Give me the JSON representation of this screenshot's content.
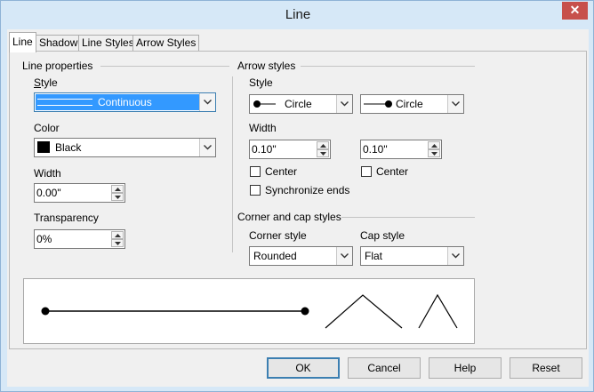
{
  "window": {
    "title": "Line",
    "close_glyph": "✕"
  },
  "tabs": [
    {
      "label": "Line",
      "active": true
    },
    {
      "label": "Shadow",
      "active": false
    },
    {
      "label": "Line Styles",
      "active": false
    },
    {
      "label": "Arrow Styles",
      "active": false
    }
  ],
  "line_properties": {
    "title": "Line properties",
    "style_label": "Style",
    "style_value": "Continuous",
    "color_label": "Color",
    "color_value": "Black",
    "color_swatch": "#000000",
    "width_label": "Width",
    "width_value": "0.00\"",
    "transparency_label": "Transparency",
    "transparency_value": "0%"
  },
  "arrow_styles": {
    "title": "Arrow styles",
    "style_label": "Style",
    "start_style": "Circle",
    "end_style": "Circle",
    "width_label": "Width",
    "start_width": "0.10\"",
    "end_width": "0.10\"",
    "center_label": "Center",
    "center_start_checked": false,
    "center_end_checked": false,
    "sync_label": "Synchronize ends",
    "sync_checked": false
  },
  "corner_cap": {
    "title": "Corner and cap styles",
    "corner_label": "Corner style",
    "corner_value": "Rounded",
    "cap_label": "Cap style",
    "cap_value": "Flat"
  },
  "buttons": {
    "ok": "OK",
    "cancel": "Cancel",
    "help": "Help",
    "reset": "Reset"
  },
  "colors": {
    "selection": "#3399ff",
    "default_button_border": "#3c7fb1"
  }
}
